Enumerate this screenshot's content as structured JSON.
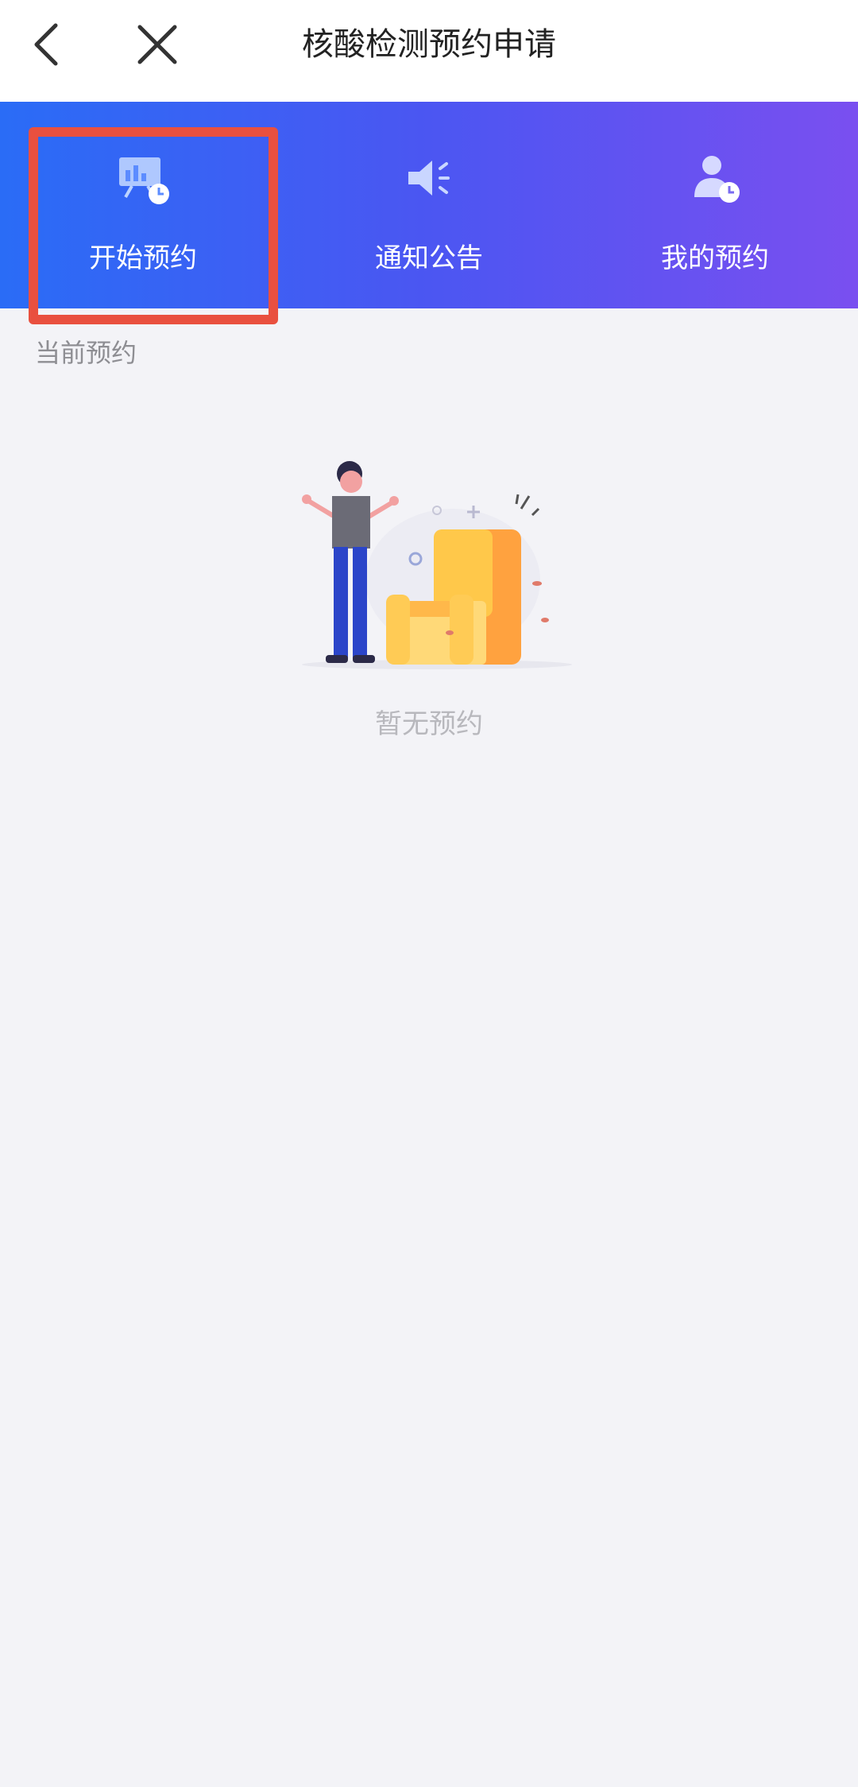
{
  "nav": {
    "title": "核酸检测预约申请",
    "back_icon": "chevron-left-icon",
    "close_icon": "close-icon"
  },
  "banner": {
    "gradient_start": "#2a6cf6",
    "gradient_end": "#7a4ff0",
    "items": [
      {
        "label": "开始预约",
        "icon": "presentation-clock-icon"
      },
      {
        "label": "通知公告",
        "icon": "megaphone-icon"
      },
      {
        "label": "我的预约",
        "icon": "user-clock-icon"
      }
    ]
  },
  "highlight_color": "#e9503f",
  "current": {
    "section_label": "当前预约",
    "empty_text": "暂无预约",
    "empty_icon": "empty-state-person-sofa-illustration"
  }
}
